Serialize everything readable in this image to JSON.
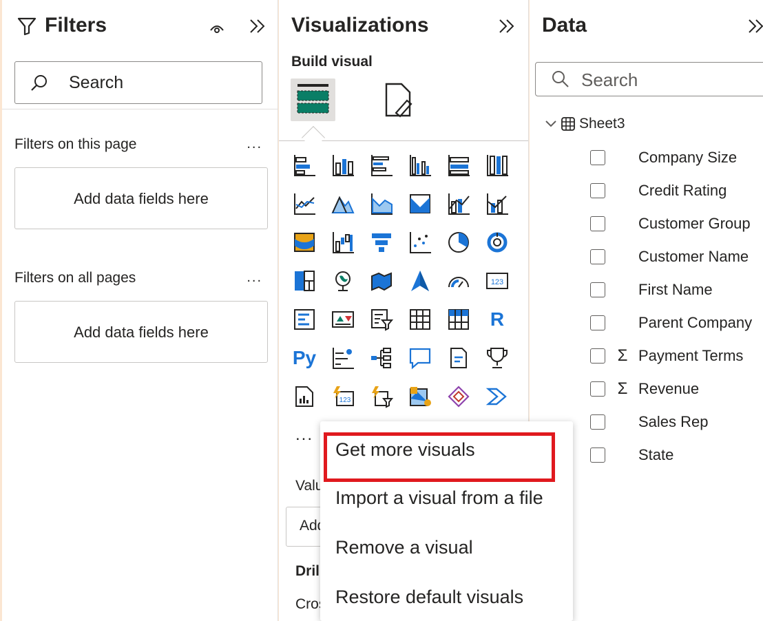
{
  "filters_pane": {
    "title": "Filters",
    "search_placeholder": "Search",
    "sections": [
      {
        "label": "Filters on this page",
        "more": "...",
        "drop_text": "Add data fields here"
      },
      {
        "label": "Filters on all pages",
        "more": "...",
        "drop_text": "Add data fields here"
      }
    ]
  },
  "visualizations_pane": {
    "title": "Visualizations",
    "build_visual_label": "Build visual",
    "more_dots": "...",
    "text_icons": {
      "r": "R",
      "py": "Py",
      "card_123": "123"
    },
    "hidden_labels": {
      "values": "Valu",
      "add": "Add",
      "drill": "Dril",
      "cross": "Cros"
    }
  },
  "data_pane": {
    "title": "Data",
    "search_placeholder": "Search",
    "table_name": "Sheet3",
    "fields": [
      {
        "name": "Company Size",
        "sigma": ""
      },
      {
        "name": "Credit Rating",
        "sigma": ""
      },
      {
        "name": "Customer Group",
        "sigma": ""
      },
      {
        "name": "Customer Name",
        "sigma": ""
      },
      {
        "name": "First Name",
        "sigma": ""
      },
      {
        "name": "Parent Company",
        "sigma": ""
      },
      {
        "name": "Payment Terms",
        "sigma": "Σ"
      },
      {
        "name": "Revenue",
        "sigma": "Σ"
      },
      {
        "name": "Sales Rep",
        "sigma": ""
      },
      {
        "name": "State",
        "sigma": ""
      }
    ]
  },
  "context_menu": {
    "items": [
      "Get more visuals",
      "Import a visual from a file",
      "Remove a visual",
      "Restore default visuals"
    ],
    "highlight_color": "#e0191e"
  },
  "colors": {
    "accent_blue": "#1b74d6",
    "teal": "#0a7e66",
    "orange": "#e8a317"
  }
}
